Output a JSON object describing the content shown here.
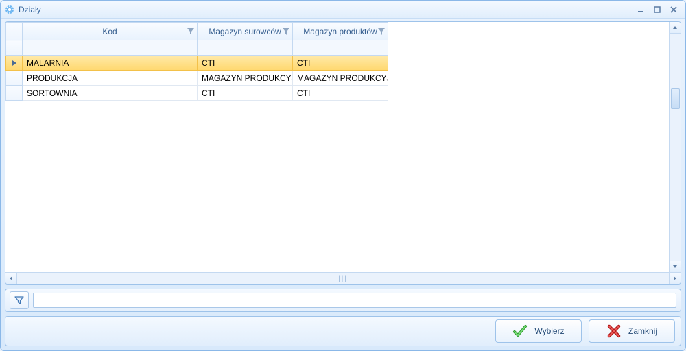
{
  "window": {
    "title": "Działy"
  },
  "columns": {
    "col1": "Kod",
    "col2": "Magazyn surowców",
    "col3": "Magazyn produktów"
  },
  "rows": [
    {
      "kod": "MALARNIA",
      "mag_sur": "CTI",
      "mag_prod": "CTI",
      "selected": true
    },
    {
      "kod": "PRODUKCJA",
      "mag_sur": "MAGAZYN PRODUKCYJNY",
      "mag_prod": "MAGAZYN PRODUKCYJNY",
      "selected": false
    },
    {
      "kod": "SORTOWNIA",
      "mag_sur": "CTI",
      "mag_prod": "CTI",
      "selected": false
    }
  ],
  "filter": {
    "value": ""
  },
  "buttons": {
    "select": "Wybierz",
    "close": "Zamknij"
  }
}
